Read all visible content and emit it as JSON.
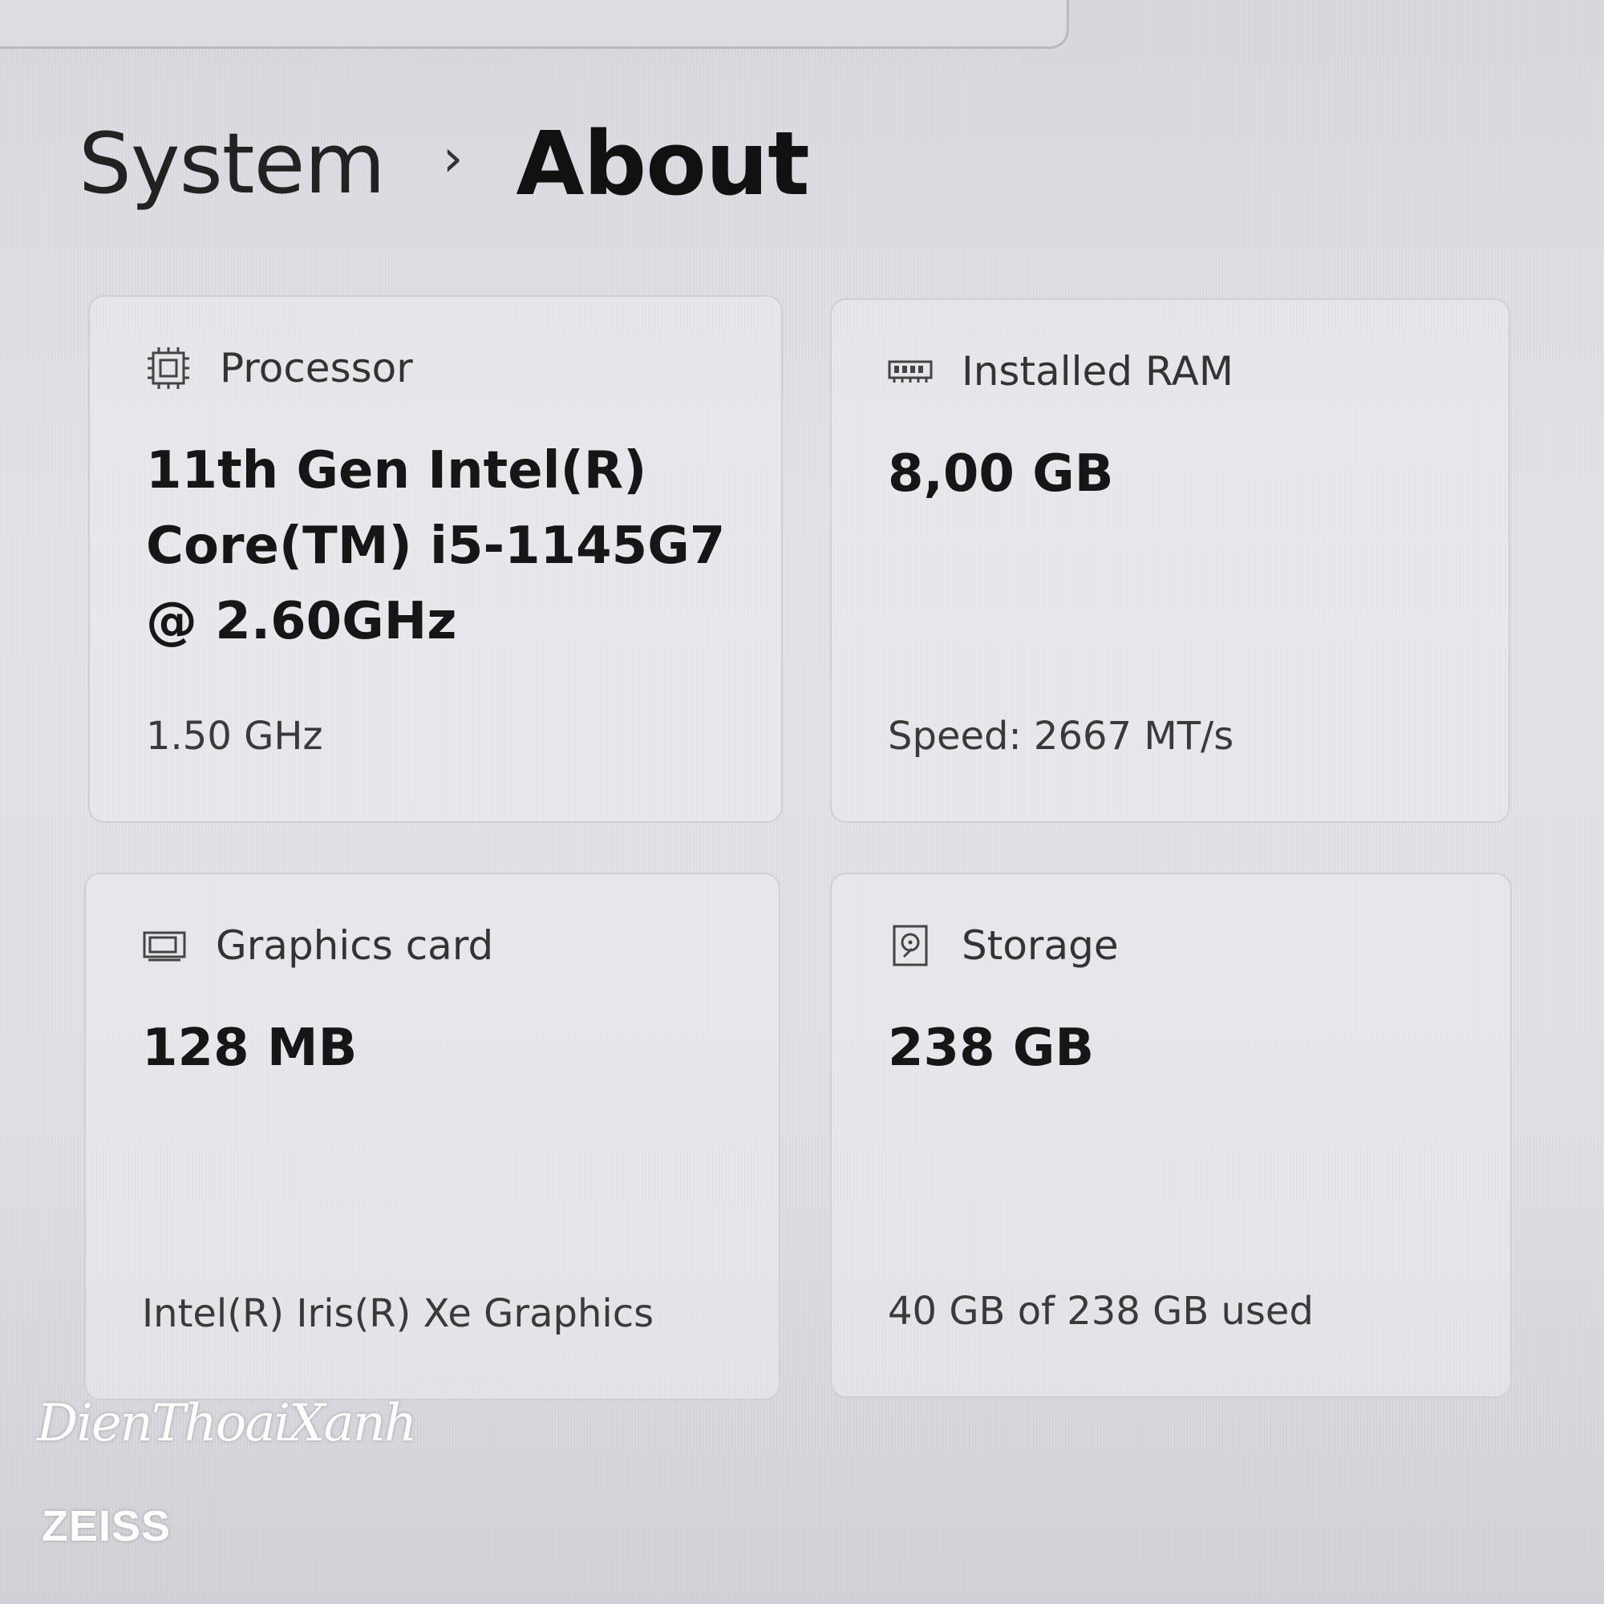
{
  "breadcrumb": {
    "parent": "System",
    "separator": "›",
    "current": "About"
  },
  "cards": {
    "processor": {
      "icon": "processor-chip-icon",
      "title": "Processor",
      "value": "11th Gen Intel(R) Core(TM) i5-1145G7 @ 2.60GHz",
      "detail": "1.50 GHz"
    },
    "ram": {
      "icon": "memory-module-icon",
      "title": "Installed RAM",
      "value": "8,00 GB",
      "detail": "Speed: 2667 MT/s"
    },
    "graphics": {
      "icon": "graphics-card-icon",
      "title": "Graphics card",
      "value": "128 MB",
      "detail": "Intel(R) Iris(R) Xe Graphics"
    },
    "storage": {
      "icon": "hard-drive-icon",
      "title": "Storage",
      "value": "238 GB",
      "detail": "40 GB of 238 GB used"
    }
  },
  "watermark": {
    "brand": "DienThoaiXanh",
    "lens": "ZEISS"
  },
  "colors": {
    "background": "#e0e1e5",
    "card_border": "#cfd0d4",
    "text_primary": "#161616",
    "text_secondary": "#3a3a3a"
  }
}
